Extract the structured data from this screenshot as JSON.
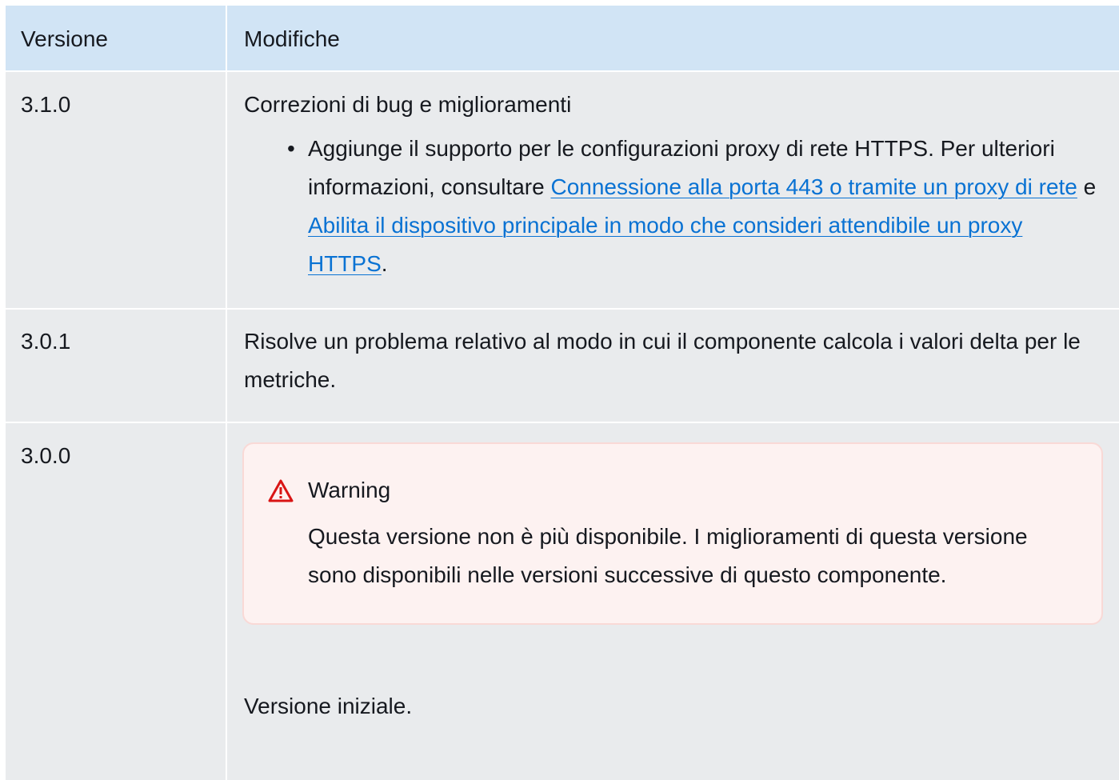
{
  "table": {
    "headers": {
      "version": "Versione",
      "changes": "Modifiche"
    },
    "rows": [
      {
        "version": "3.1.0",
        "summary": "Correzioni di bug e miglioramenti",
        "bullet": {
          "text_before": "Aggiunge il supporto per le configurazioni proxy di rete HTTPS. Per ulteriori informazioni, consultare ",
          "link1": "Connessione alla porta 443 o tramite un proxy di rete",
          "text_between": " e ",
          "link2": "Abilita il dispositivo principale in modo che consideri attendibile un proxy HTTPS",
          "text_after": "."
        }
      },
      {
        "version": "3.0.1",
        "summary": "Risolve un problema relativo al modo in cui il componente calcola i valori delta per le metriche."
      },
      {
        "version": "3.0.0",
        "warning": {
          "title": "Warning",
          "body": "Questa versione non è più disponibile. I miglioramenti di questa versione sono disponibili nelle versioni successive di questo componente."
        },
        "summary": "Versione iniziale."
      }
    ]
  },
  "colors": {
    "header_bg": "#d1e4f5",
    "row_bg": "#e9ebed",
    "link": "#0972d3",
    "warning_bg": "#fdf2f1",
    "warning_border": "#f9d9d6",
    "warning_icon": "#d91515"
  },
  "icons": {
    "warning": "warning-triangle-icon"
  }
}
